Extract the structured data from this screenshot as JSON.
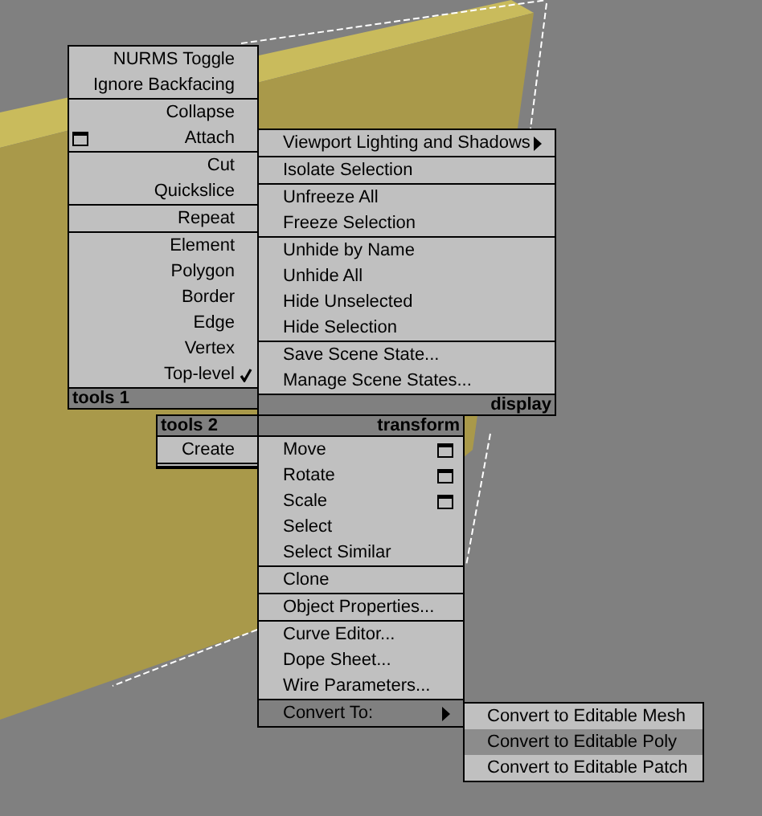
{
  "menus": [
    {
      "header": "tools 1",
      "groups": [
        [
          {
            "label": "NURMS Toggle"
          },
          {
            "label": "Ignore Backfacing"
          }
        ],
        [
          {
            "label": "Collapse"
          },
          {
            "label": "Attach",
            "option_box": true
          }
        ],
        [
          {
            "label": "Cut"
          },
          {
            "label": "Quickslice"
          }
        ],
        [
          {
            "label": "Repeat"
          }
        ],
        [
          {
            "label": "Element",
            "checked": false
          },
          {
            "label": "Polygon",
            "checked": false
          },
          {
            "label": "Border",
            "checked": false
          },
          {
            "label": "Edge",
            "checked": false
          },
          {
            "label": "Vertex",
            "checked": false
          },
          {
            "label": "Top-level",
            "checked": true
          }
        ]
      ]
    },
    {
      "header": "display",
      "groups": [
        [
          {
            "label": "Viewport Lighting and Shadows",
            "submenu": true
          }
        ],
        [
          {
            "label": "Isolate Selection"
          }
        ],
        [
          {
            "label": "Unfreeze All"
          },
          {
            "label": "Freeze Selection"
          }
        ],
        [
          {
            "label": "Unhide by Name"
          },
          {
            "label": "Unhide All"
          },
          {
            "label": "Hide Unselected"
          },
          {
            "label": "Hide Selection"
          }
        ],
        [
          {
            "label": "Save Scene State..."
          },
          {
            "label": "Manage Scene States..."
          }
        ]
      ]
    },
    {
      "header": "tools 2",
      "groups": [
        [
          {
            "label": "Create"
          }
        ]
      ]
    },
    {
      "header": "transform",
      "groups": [
        [
          {
            "label": "Move",
            "option_box": true
          },
          {
            "label": "Rotate",
            "option_box": true
          },
          {
            "label": "Scale",
            "option_box": true
          },
          {
            "label": "Select"
          },
          {
            "label": "Select Similar"
          }
        ],
        [
          {
            "label": "Clone"
          }
        ],
        [
          {
            "label": "Object Properties..."
          }
        ],
        [
          {
            "label": "Curve Editor..."
          },
          {
            "label": "Dope Sheet..."
          },
          {
            "label": "Wire Parameters..."
          }
        ],
        [
          {
            "label": "Convert To:",
            "submenu": true,
            "selected": true
          }
        ]
      ]
    }
  ],
  "submenu": {
    "items": [
      {
        "label": "Convert to Editable Mesh",
        "selected": false
      },
      {
        "label": "Convert to Editable Poly",
        "selected": true
      },
      {
        "label": "Convert to Editable Patch",
        "selected": false
      }
    ]
  }
}
